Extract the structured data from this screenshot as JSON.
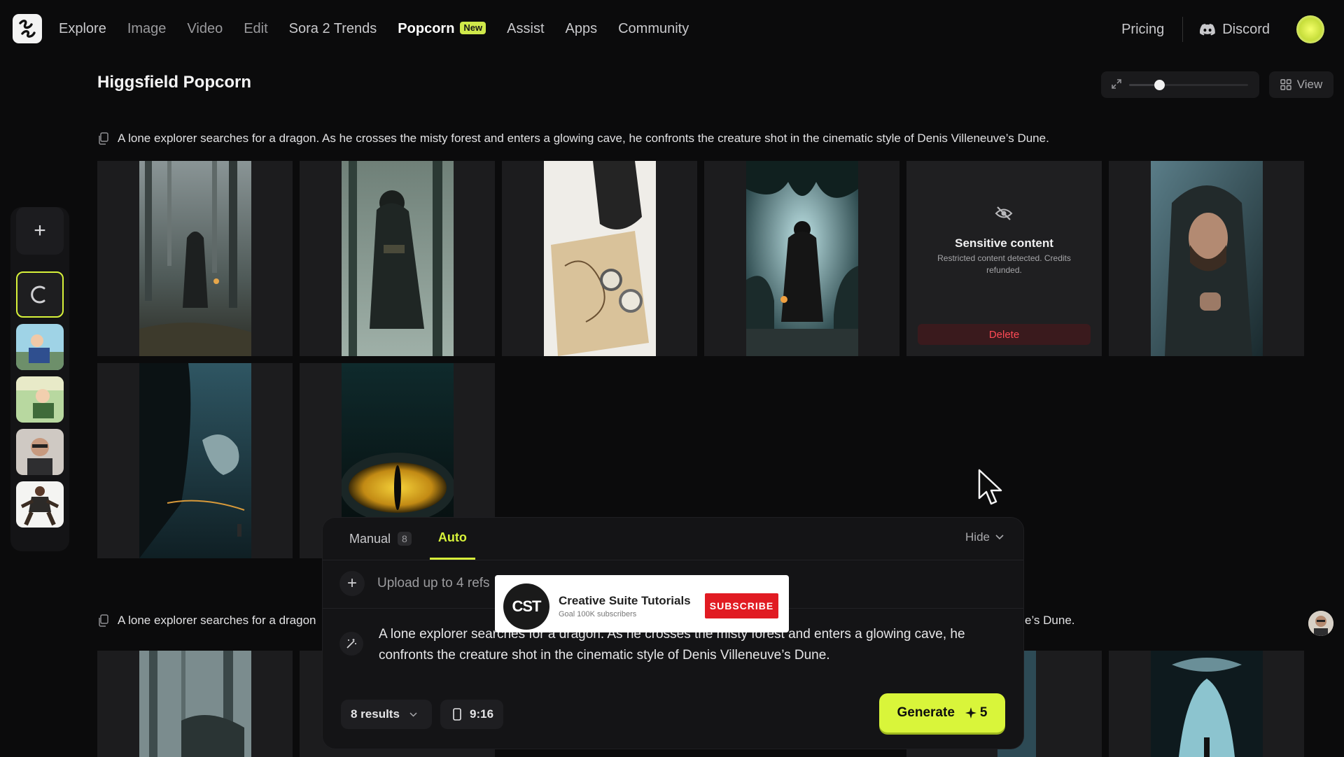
{
  "nav": {
    "items": [
      {
        "label": "Explore",
        "state": "strong"
      },
      {
        "label": "Image",
        "state": "normal"
      },
      {
        "label": "Video",
        "state": "normal"
      },
      {
        "label": "Edit",
        "state": "normal"
      },
      {
        "label": "Sora 2 Trends",
        "state": "strong"
      },
      {
        "label": "Popcorn",
        "state": "active"
      },
      {
        "label": "Assist",
        "state": "strong"
      },
      {
        "label": "Apps",
        "state": "strong"
      },
      {
        "label": "Community",
        "state": "strong"
      }
    ],
    "new_badge": "New",
    "pricing": "Pricing",
    "discord": "Discord"
  },
  "page": {
    "title": "Higgsfield Popcorn",
    "zoom_level": 0.25,
    "view_label": "View"
  },
  "generation_1": {
    "prompt": "A lone explorer searches for a dragon. As he crosses the misty forest and enters a glowing cave, he confronts the creature shot in the cinematic style of Denis Villeneuve’s Dune.",
    "sensitive": {
      "title": "Sensitive content",
      "subtitle": "Restricted content detected. Credits refunded.",
      "delete": "Delete"
    }
  },
  "generation_2": {
    "prompt_left": "A lone explorer searches for a dragon",
    "prompt_right": "e’s Dune."
  },
  "composer": {
    "tab_manual": "Manual",
    "tab_manual_count": "8",
    "tab_auto": "Auto",
    "hide": "Hide",
    "upload_text": "Upload up to 4 refs",
    "prompt": "A lone explorer searches for a dragon. As he crosses the misty forest and enters a glowing cave, he confronts the creature shot in the cinematic style of Denis Villeneuve’s Dune.",
    "results": "8 results",
    "ratio": "9:16",
    "generate": "Generate",
    "cost": "5"
  },
  "overlay": {
    "logo_text": "CST",
    "channel": "Creative Suite Tutorials",
    "goal": "Goal 100K subscribers",
    "subscribe": "SUBSCRIBE"
  },
  "colors": {
    "accent": "#d9f53a",
    "background": "#0b0b0c",
    "danger": "#ff4a55",
    "subscribe": "#e11b22"
  }
}
